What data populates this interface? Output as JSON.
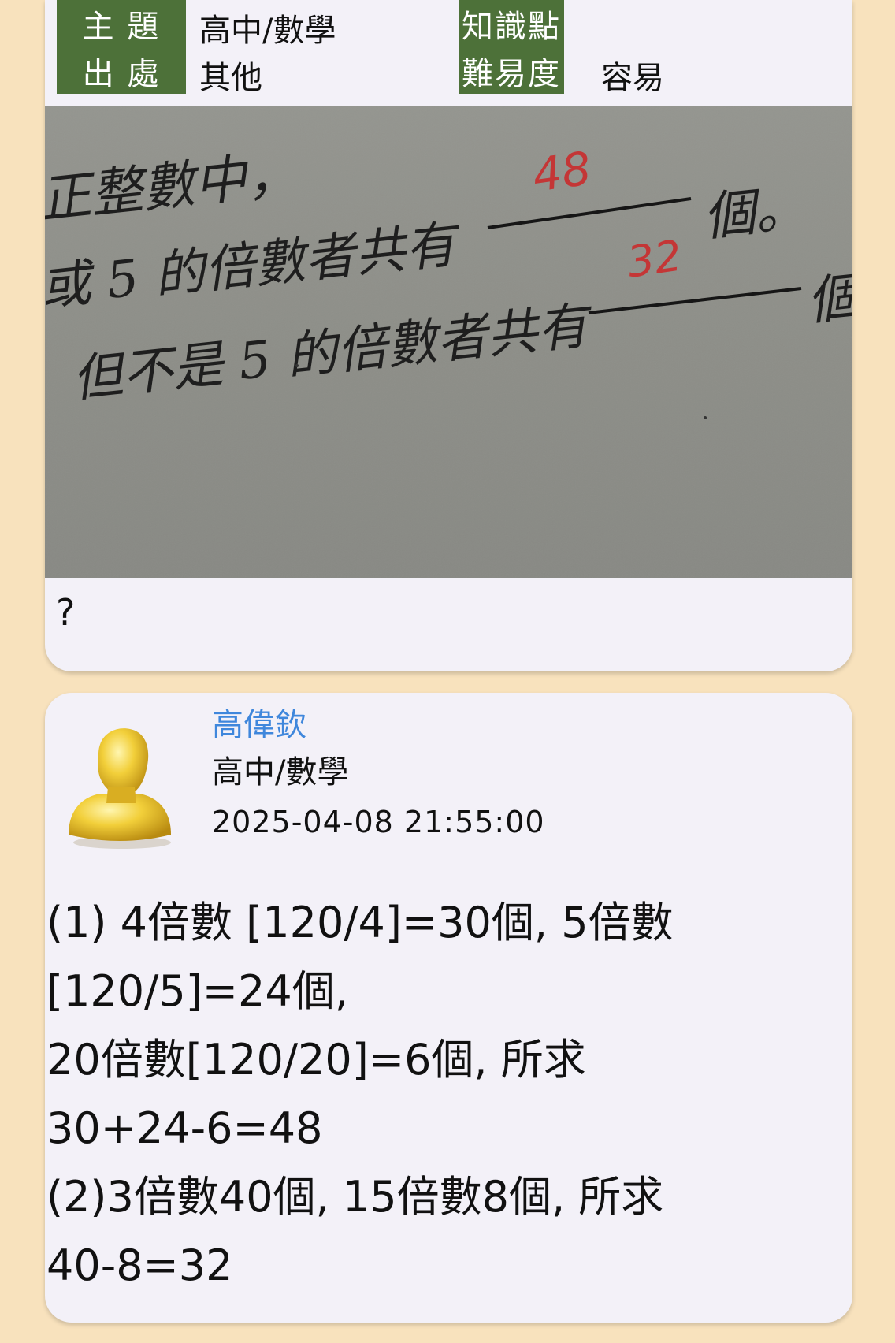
{
  "meta": {
    "topic_label": "主 題",
    "topic_value": "高中/數學",
    "knowledge_label": "知識點",
    "knowledge_value": "",
    "source_label": "出 處",
    "source_value": "其他",
    "difficulty_label": "難易度",
    "difficulty_value": "容易"
  },
  "photo": {
    "line1": "正整數中，",
    "line2": "或 5 的倍數者共有",
    "answer1": "48",
    "unit": "個。",
    "line3": "但不是 5 的倍數者共有",
    "answer2": "32",
    "unit2": "個"
  },
  "question": {
    "text": "?"
  },
  "answer_card": {
    "author": "高偉欽",
    "subject": "高中/數學",
    "timestamp": "2025-04-08 21:55:00",
    "lines": [
      "(1) 4倍數 [120/4]=30個, 5倍數",
      "[120/5]=24個,",
      "20倍數[120/20]=6個, 所求",
      "30+24-6=48",
      "(2)3倍數40個, 15倍數8個, 所求",
      "40-8=32"
    ]
  }
}
